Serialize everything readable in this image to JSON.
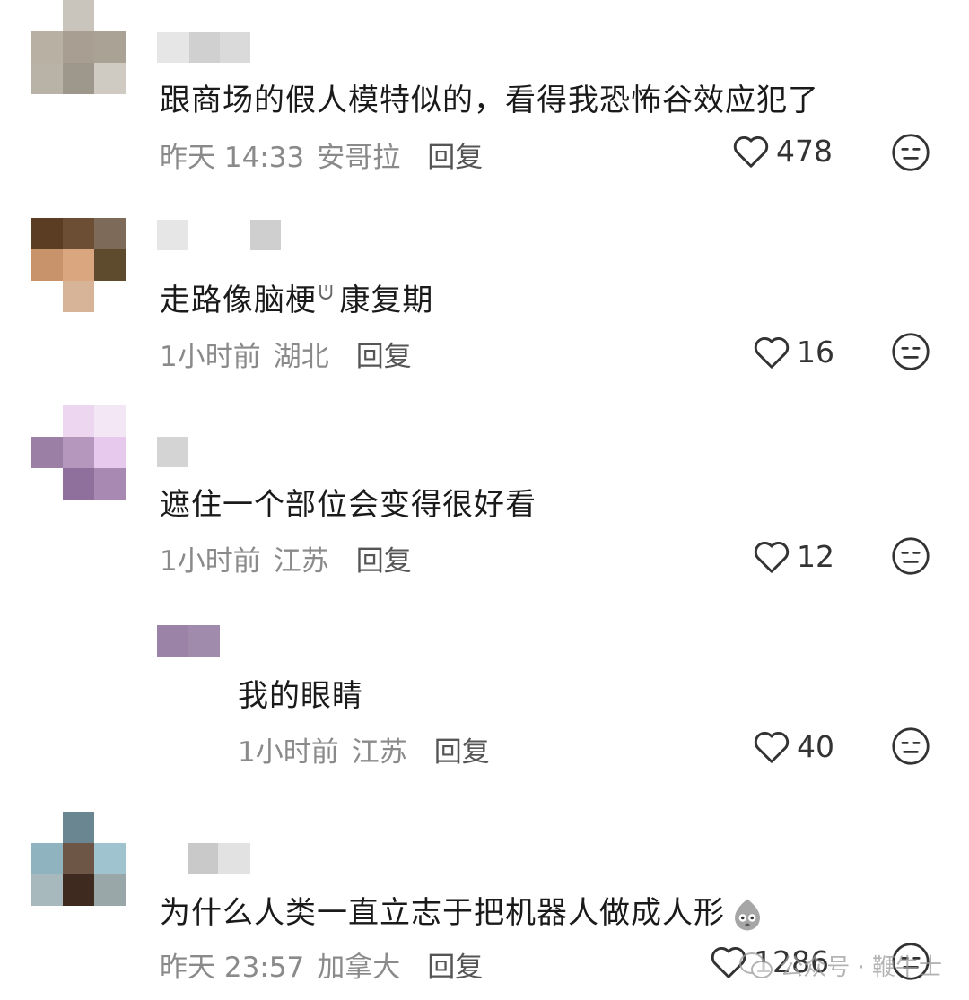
{
  "comments": [
    {
      "text": "跟商场的假人模特似的，看得我恐怖谷效应犯了",
      "time": "昨天 14:33",
      "location": "安哥拉",
      "reply": "回复",
      "likes": "478"
    },
    {
      "text_main": "走路像脑梗",
      "search_mark": "ᕫ",
      "text_tail": "康复期",
      "time": "1小时前",
      "location": "湖北",
      "reply": "回复",
      "likes": "16"
    },
    {
      "text": "遮住一个部位会变得很好看",
      "time": "1小时前",
      "location": "江苏",
      "reply": "回复",
      "likes": "12"
    },
    {
      "text": "我的眼睛",
      "time": "1小时前",
      "location": "江苏",
      "reply": "回复",
      "likes": "40"
    },
    {
      "text": "为什么人类一直立志于把机器人做成人形",
      "time": "昨天 23:57",
      "location": "加拿大",
      "reply": "回复",
      "likes": "1286"
    }
  ],
  "watermark": "公众号 · 鞭牛士",
  "colors": {
    "text": "#1a1a1a",
    "meta": "#8a8a8a",
    "reply": "#555555"
  }
}
